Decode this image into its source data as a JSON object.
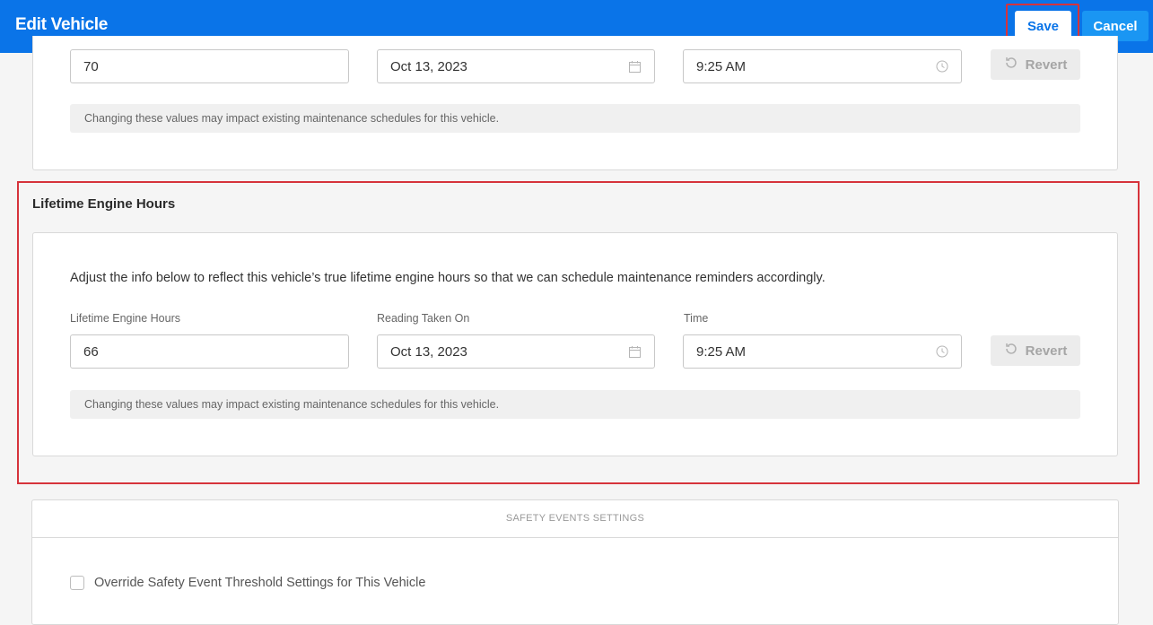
{
  "header": {
    "title": "Edit Vehicle",
    "save_label": "Save",
    "cancel_label": "Cancel",
    "accent": "#0a74e8"
  },
  "odometer_section": {
    "value": "70",
    "date": "Oct 13, 2023",
    "time": "9:25 AM",
    "revert_label": "Revert",
    "note": "Changing these values may impact existing maintenance schedules for this vehicle."
  },
  "engine_hours_section": {
    "title": "Lifetime Engine Hours",
    "description": "Adjust the info below to reflect this vehicle’s true lifetime engine hours so that we can schedule maintenance reminders accordingly.",
    "hours_label": "Lifetime Engine Hours",
    "hours_value": "66",
    "date_label": "Reading Taken On",
    "date_value": "Oct 13, 2023",
    "time_label": "Time",
    "time_value": "9:25 AM",
    "revert_label": "Revert",
    "note": "Changing these values may impact existing maintenance schedules for this vehicle."
  },
  "safety_section": {
    "header": "SAFETY EVENTS SETTINGS",
    "override_label": "Override Safety Event Threshold Settings for This Vehicle",
    "override_checked": false
  },
  "icons": {
    "date": "calendar-icon",
    "time": "clock-icon",
    "revert": "undo-icon"
  }
}
